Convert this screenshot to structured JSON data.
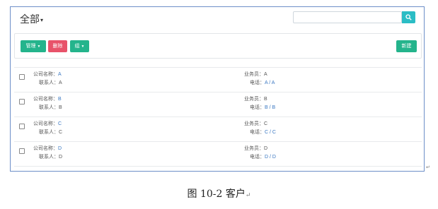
{
  "header": {
    "title": "全部",
    "search_placeholder": ""
  },
  "toolbar": {
    "manage_label": "管理",
    "delete_label": "删除",
    "group_label": "组",
    "new_label": "新建"
  },
  "labels": {
    "company": "公司名称：",
    "contact": "联系人：",
    "salesperson": "业务员：",
    "phone": "电话："
  },
  "rows": [
    {
      "company": "A",
      "contact": "A",
      "salesperson": "A",
      "phone1": "A",
      "phone2": "A"
    },
    {
      "company": "B",
      "contact": "B",
      "salesperson": "B",
      "phone1": "B",
      "phone2": "B"
    },
    {
      "company": "C",
      "contact": "C",
      "salesperson": "C",
      "phone1": "C",
      "phone2": "C"
    },
    {
      "company": "D",
      "contact": "D",
      "salesperson": "D",
      "phone1": "D",
      "phone2": "D"
    }
  ],
  "phone_separator": " / ",
  "caption": "图 10-2 客户",
  "paragraph_mark": "↵",
  "colors": {
    "accent": "#24b48c",
    "danger": "#e8536a",
    "search": "#2bbdc5",
    "link": "#3b78c2"
  }
}
